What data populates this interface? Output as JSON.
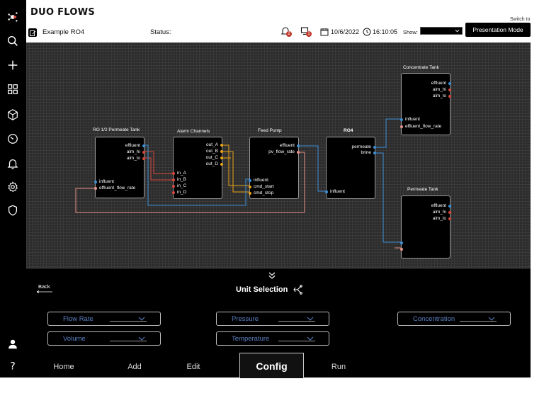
{
  "app": {
    "brand": "DUO FLOWS"
  },
  "header": {
    "project_name": "Example RO4",
    "status_label": "Status:",
    "alerts_badge": "2",
    "messages_badge": "1",
    "date": "10/6/2022",
    "time": "16:10:05",
    "show_label": "Show:",
    "switch_to_label": "Switch to",
    "presentation_button": "Presentation Mode"
  },
  "colors": {
    "wire_blue": "#3a8fd6",
    "wire_red": "#d8473c",
    "wire_yellow": "#e8a317",
    "wire_salmon": "#e8928a",
    "dropdown_text": "#5a7fc0"
  },
  "canvas": {
    "nodes": {
      "ro_permeate": {
        "title": "RO 1/2 Permeate Tank",
        "outputs": [
          "effluent",
          "alm_hi",
          "alm_lo"
        ],
        "inputs": [
          "influent",
          "effluent_flow_rate"
        ]
      },
      "alarm": {
        "title": "Alarm Channels",
        "outputs": [
          "out_A",
          "out_B",
          "out_C",
          "out_D"
        ],
        "inputs": [
          "in_A",
          "in_B",
          "in_C",
          "in_D"
        ]
      },
      "feed": {
        "title": "Feed Pump",
        "outputs": [
          "effluent",
          "pv_flow_rate"
        ],
        "inputs": [
          "influent",
          "cmd_start",
          "cmd_stop"
        ]
      },
      "ro4": {
        "title": "RO4",
        "outputs": [
          "permeate",
          "brine"
        ],
        "inputs": [
          "influent"
        ]
      },
      "conc": {
        "title": "Concentrate Tank",
        "outputs": [
          "effluent",
          "alm_hi",
          "alm_lo"
        ],
        "inputs": [
          "influent",
          "effluent_flow_rate"
        ]
      },
      "perm": {
        "title": "Permeate Tank",
        "outputs": [
          "effluent",
          "alm_hi",
          "alm_lo"
        ],
        "inputs": []
      }
    }
  },
  "panel": {
    "back_label": "Back",
    "title": "Unit Selection",
    "dropdowns": {
      "flow_rate": "Flow Rate",
      "volume": "Volume",
      "pressure": "Pressure",
      "temperature": "Temperature",
      "concentration": "Concentration"
    }
  },
  "tabs": {
    "home": "Home",
    "add": "Add",
    "edit": "Edit",
    "config": "Config",
    "run": "Run",
    "active": "config"
  },
  "icons": {
    "rail": [
      "flows-logo-icon",
      "search-icon",
      "plus-icon",
      "grid-icon",
      "cube-icon",
      "gauge-icon",
      "bell-icon",
      "gear-icon",
      "shield-icon",
      "user-icon",
      "help-icon"
    ]
  }
}
